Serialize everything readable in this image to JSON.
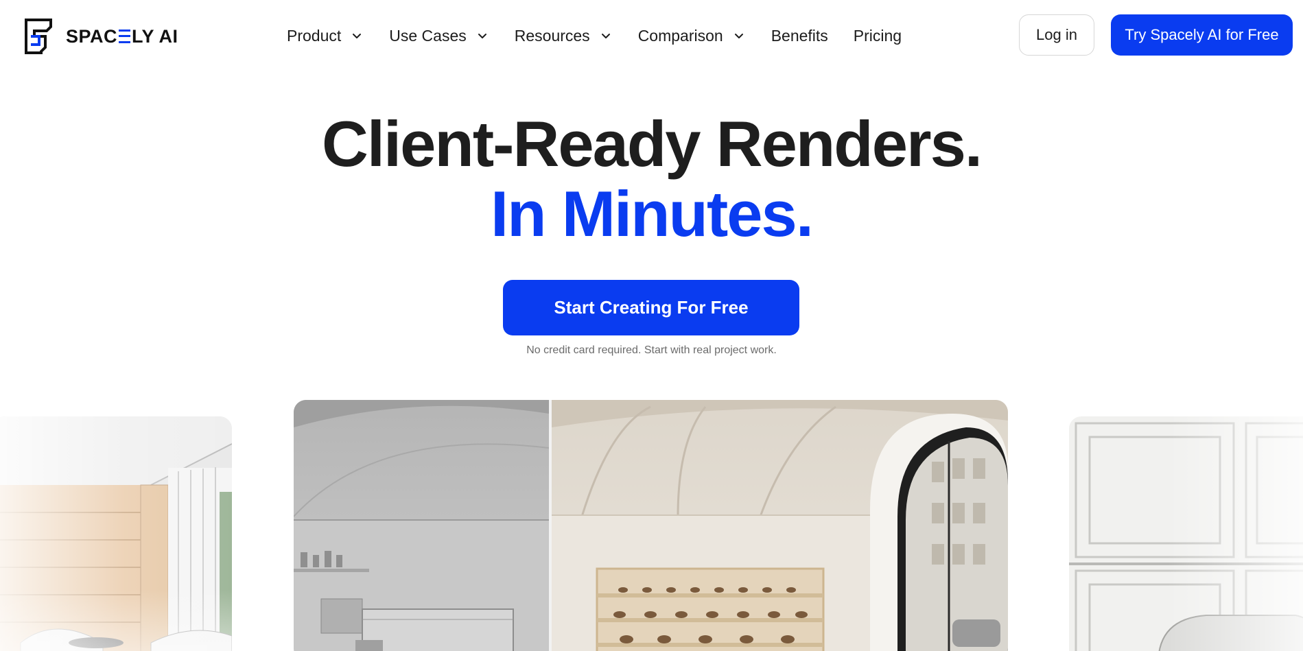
{
  "brand": {
    "name_prefix": "SPAC",
    "name_suffix": "LY AI",
    "accent_color": "#0a3cf0"
  },
  "nav": {
    "items": [
      {
        "label": "Product",
        "has_dropdown": true
      },
      {
        "label": "Use Cases",
        "has_dropdown": true
      },
      {
        "label": "Resources",
        "has_dropdown": true
      },
      {
        "label": "Comparison",
        "has_dropdown": true
      },
      {
        "label": "Benefits",
        "has_dropdown": false
      },
      {
        "label": "Pricing",
        "has_dropdown": false
      }
    ],
    "login_label": "Log in",
    "try_label": "Try Spacely AI for Free"
  },
  "hero": {
    "title": "Client-Ready Renders.",
    "title_accent": "In Minutes.",
    "cta_label": "Start Creating For Free",
    "cta_note": "No credit card required. Start with real project work."
  },
  "colors": {
    "primary": "#0a3cf0",
    "text": "#1e1e1e",
    "muted": "#6b6b6b"
  },
  "icons": {
    "logo": "spacely-logo-mark",
    "dropdown": "chevron-down-icon"
  }
}
